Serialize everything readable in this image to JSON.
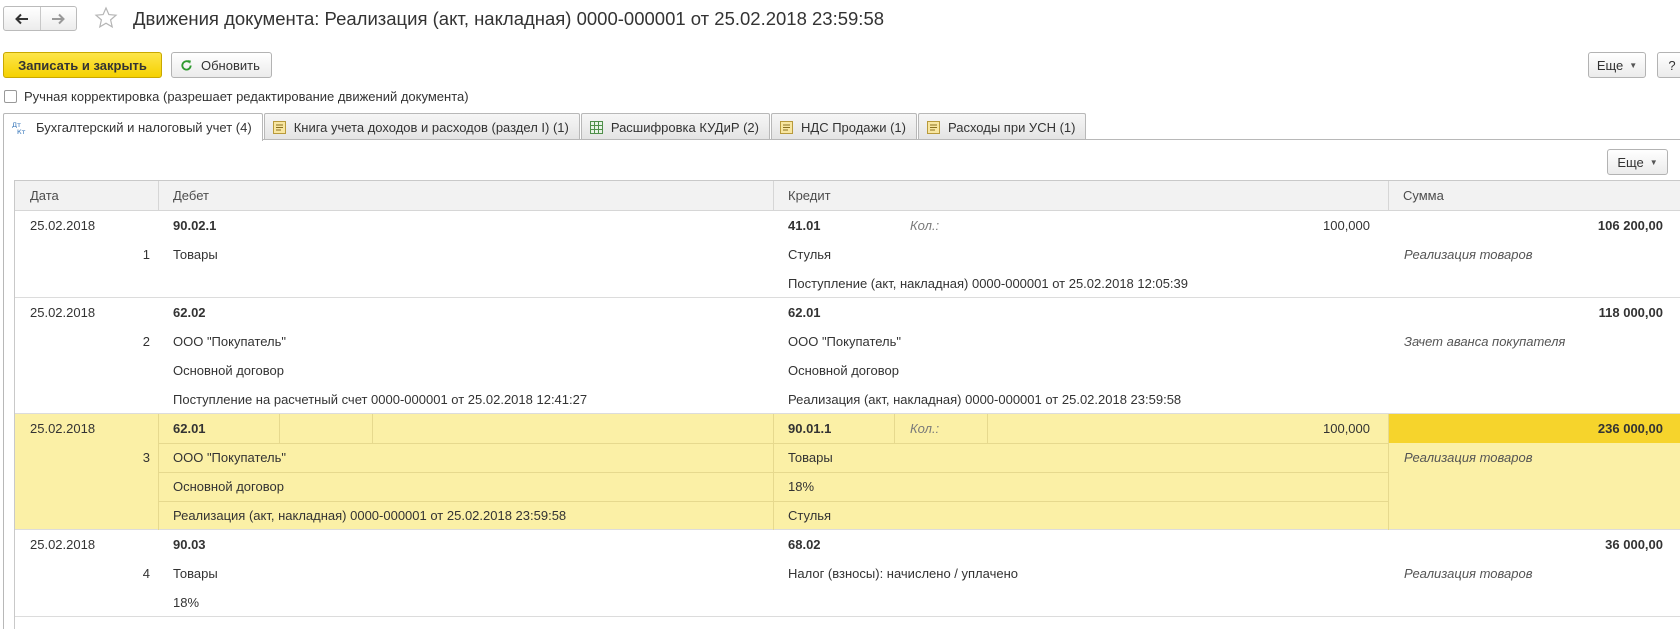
{
  "header": {
    "title": "Движения документа: Реализация (акт, накладная) 0000-000001 от 25.02.2018 23:59:58"
  },
  "toolbar": {
    "save_close": "Записать и закрыть",
    "refresh": "Обновить",
    "more": "Еще",
    "help": "?"
  },
  "manual_edit": {
    "label": "Ручная корректировка (разрешает редактирование движений документа)",
    "checked": false
  },
  "tabs": [
    {
      "label": "Бухгалтерский и налоговый учет (4)",
      "icon": "dt-kt-icon",
      "active": true
    },
    {
      "label": "Книга учета доходов и расходов (раздел I) (1)",
      "icon": "register-icon",
      "active": false
    },
    {
      "label": "Расшифровка КУДиР (2)",
      "icon": "table-icon",
      "active": false
    },
    {
      "label": "НДС Продажи (1)",
      "icon": "register-icon",
      "active": false
    },
    {
      "label": "Расходы при УСН (1)",
      "icon": "register-icon",
      "active": false
    }
  ],
  "table": {
    "more": "Еще",
    "columns": {
      "date": "Дата",
      "debit": "Дебет",
      "credit": "Кредит",
      "sum": "Сумма"
    },
    "kol_label": "Кол.:",
    "rows": [
      {
        "date": "25.02.2018",
        "num": "1",
        "debit": [
          "90.02.1",
          "Товары"
        ],
        "credit": [
          "41.01",
          "Стулья",
          "Поступление (акт, накладная) 0000-000001 от 25.02.2018 12:05:39"
        ],
        "qty": "100,000",
        "sum": "106 200,00",
        "content": "Реализация товаров"
      },
      {
        "date": "25.02.2018",
        "num": "2",
        "debit": [
          "62.02",
          "ООО \"Покупатель\"",
          "Основной договор",
          "Поступление на расчетный счет 0000-000001 от 25.02.2018 12:41:27"
        ],
        "credit": [
          "62.01",
          "ООО \"Покупатель\"",
          "Основной договор",
          "Реализация (акт, накладная) 0000-000001 от 25.02.2018 23:59:58"
        ],
        "sum": "118 000,00",
        "content": "Зачет аванса покупателя"
      },
      {
        "date": "25.02.2018",
        "num": "3",
        "debit": [
          "62.01",
          "ООО \"Покупатель\"",
          "Основной договор",
          "Реализация (акт, накладная) 0000-000001 от 25.02.2018 23:59:58"
        ],
        "credit": [
          "90.01.1",
          "Товары",
          "18%",
          "Стулья"
        ],
        "qty": "100,000",
        "sum": "236 000,00",
        "content": "Реализация товаров"
      },
      {
        "date": "25.02.2018",
        "num": "4",
        "debit": [
          "90.03",
          "Товары",
          "18%"
        ],
        "credit": [
          "68.02",
          "Налог (взносы): начислено / уплачено"
        ],
        "sum": "36 000,00",
        "content": "Реализация товаров"
      }
    ]
  },
  "colors": {
    "accent": "#f5d100",
    "selection": "#fbf0a6",
    "selected_cell": "#f6d42c"
  }
}
